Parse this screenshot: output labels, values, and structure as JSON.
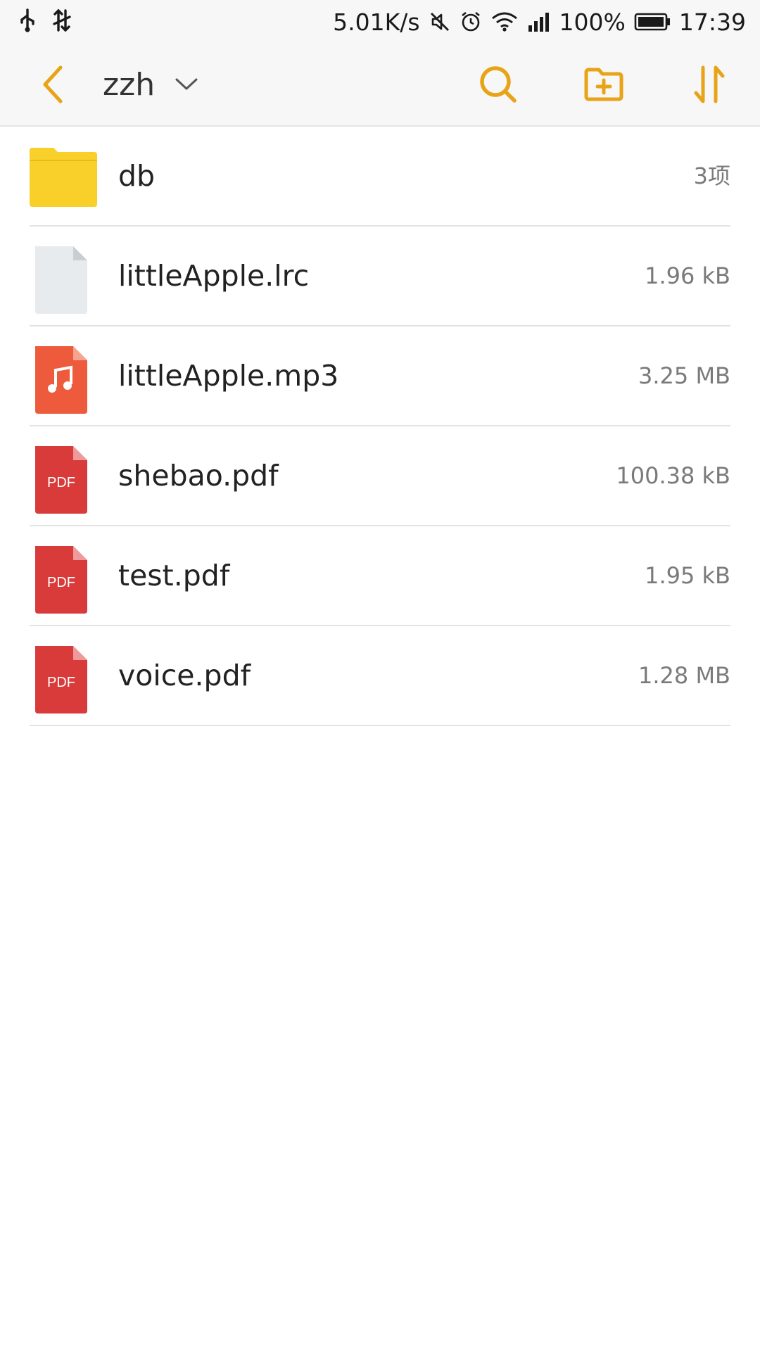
{
  "status_bar": {
    "network_speed": "5.01K/s",
    "battery": "100%",
    "time": "17:39",
    "icons": [
      "usb-icon",
      "data-sync-icon",
      "mute-icon",
      "alarm-icon",
      "wifi-icon",
      "signal-icon",
      "battery-icon"
    ]
  },
  "toolbar": {
    "title": "zzh",
    "icons": [
      "back-icon",
      "dropdown-icon",
      "search-icon",
      "new-folder-icon",
      "sort-icon"
    ],
    "accent_color": "#e8a317"
  },
  "files": [
    {
      "name": "db",
      "meta": "3项",
      "type": "folder"
    },
    {
      "name": "littleApple.lrc",
      "meta": "1.96 kB",
      "type": "text"
    },
    {
      "name": "littleApple.mp3",
      "meta": "3.25 MB",
      "type": "audio"
    },
    {
      "name": "shebao.pdf",
      "meta": "100.38 kB",
      "type": "pdf",
      "badge": "PDF"
    },
    {
      "name": "test.pdf",
      "meta": "1.95 kB",
      "type": "pdf",
      "badge": "PDF"
    },
    {
      "name": "voice.pdf",
      "meta": "1.28 MB",
      "type": "pdf",
      "badge": "PDF"
    }
  ],
  "colors": {
    "folder": "#f9cf2a",
    "audio": "#ee5a3c",
    "pdf": "#d93b3b",
    "text_file": "#e8ebee"
  }
}
